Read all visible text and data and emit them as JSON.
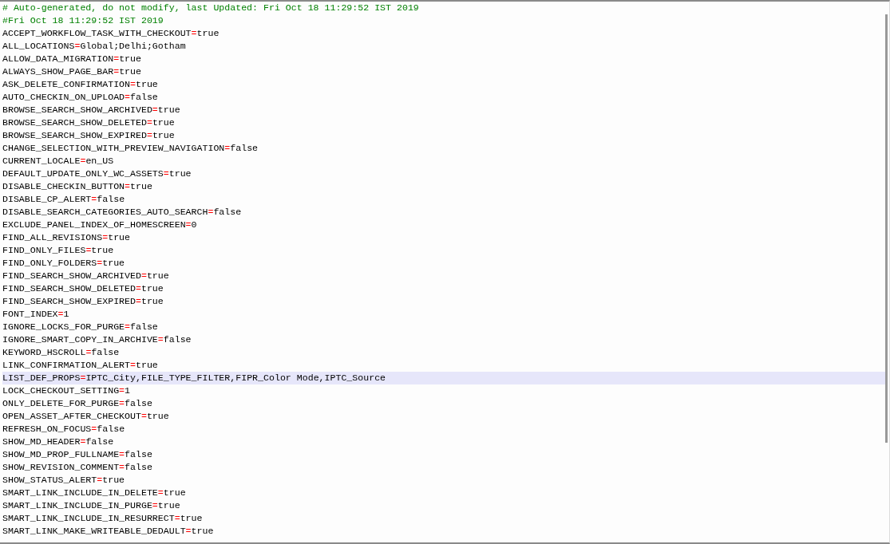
{
  "editor": {
    "comments": [
      "# Auto-generated, do not modify, last Updated: Fri Oct 18 11:29:52 IST 2019",
      "#Fri Oct 18 11:29:52 IST 2019"
    ],
    "properties": [
      {
        "key": "ACCEPT_WORKFLOW_TASK_WITH_CHECKOUT",
        "separator": "=",
        "value": "true",
        "selected": false
      },
      {
        "key": "ALL_LOCATIONS",
        "separator": "=",
        "value": "Global;Delhi;Gotham",
        "selected": false
      },
      {
        "key": "ALLOW_DATA_MIGRATION",
        "separator": "=",
        "value": "true",
        "selected": false
      },
      {
        "key": "ALWAYS_SHOW_PAGE_BAR",
        "separator": "=",
        "value": "true",
        "selected": false
      },
      {
        "key": "ASK_DELETE_CONFIRMATION",
        "separator": "=",
        "value": "true",
        "selected": false
      },
      {
        "key": "AUTO_CHECKIN_ON_UPLOAD",
        "separator": "=",
        "value": "false",
        "selected": false
      },
      {
        "key": "BROWSE_SEARCH_SHOW_ARCHIVED",
        "separator": "=",
        "value": "true",
        "selected": false
      },
      {
        "key": "BROWSE_SEARCH_SHOW_DELETED",
        "separator": "=",
        "value": "true",
        "selected": false
      },
      {
        "key": "BROWSE_SEARCH_SHOW_EXPIRED",
        "separator": "=",
        "value": "true",
        "selected": false
      },
      {
        "key": "CHANGE_SELECTION_WITH_PREVIEW_NAVIGATION",
        "separator": "=",
        "value": "false",
        "selected": false
      },
      {
        "key": "CURRENT_LOCALE",
        "separator": "=",
        "value": "en_US",
        "selected": false
      },
      {
        "key": "DEFAULT_UPDATE_ONLY_WC_ASSETS",
        "separator": "=",
        "value": "true",
        "selected": false
      },
      {
        "key": "DISABLE_CHECKIN_BUTTON",
        "separator": "=",
        "value": "true",
        "selected": false
      },
      {
        "key": "DISABLE_CP_ALERT",
        "separator": "=",
        "value": "false",
        "selected": false
      },
      {
        "key": "DISABLE_SEARCH_CATEGORIES_AUTO_SEARCH",
        "separator": "=",
        "value": "false",
        "selected": false
      },
      {
        "key": "EXCLUDE_PANEL_INDEX_OF_HOMESCREEN",
        "separator": "=",
        "value": "0",
        "selected": false
      },
      {
        "key": "FIND_ALL_REVISIONS",
        "separator": "=",
        "value": "true",
        "selected": false
      },
      {
        "key": "FIND_ONLY_FILES",
        "separator": "=",
        "value": "true",
        "selected": false
      },
      {
        "key": "FIND_ONLY_FOLDERS",
        "separator": "=",
        "value": "true",
        "selected": false
      },
      {
        "key": "FIND_SEARCH_SHOW_ARCHIVED",
        "separator": "=",
        "value": "true",
        "selected": false
      },
      {
        "key": "FIND_SEARCH_SHOW_DELETED",
        "separator": "=",
        "value": "true",
        "selected": false
      },
      {
        "key": "FIND_SEARCH_SHOW_EXPIRED",
        "separator": "=",
        "value": "true",
        "selected": false
      },
      {
        "key": "FONT_INDEX",
        "separator": "=",
        "value": "1",
        "selected": false
      },
      {
        "key": "IGNORE_LOCKS_FOR_PURGE",
        "separator": "=",
        "value": "false",
        "selected": false
      },
      {
        "key": "IGNORE_SMART_COPY_IN_ARCHIVE",
        "separator": "=",
        "value": "false",
        "selected": false
      },
      {
        "key": "KEYWORD_HSCROLL",
        "separator": "=",
        "value": "false",
        "selected": false
      },
      {
        "key": "LINK_CONFIRMATION_ALERT",
        "separator": "=",
        "value": "true",
        "selected": false
      },
      {
        "key": "LIST_DEF_PROPS",
        "separator": "=",
        "value": "IPTC_City,FILE_TYPE_FILTER,FIPR_Color Mode,IPTC_Source",
        "selected": true
      },
      {
        "key": "LOCK_CHECKOUT_SETTING",
        "separator": "=",
        "value": "1",
        "selected": false
      },
      {
        "key": "ONLY_DELETE_FOR_PURGE",
        "separator": "=",
        "value": "false",
        "selected": false
      },
      {
        "key": "OPEN_ASSET_AFTER_CHECKOUT",
        "separator": "=",
        "value": "true",
        "selected": false
      },
      {
        "key": "REFRESH_ON_FOCUS",
        "separator": "=",
        "value": "false",
        "selected": false
      },
      {
        "key": "SHOW_MD_HEADER",
        "separator": "=",
        "value": "false",
        "selected": false
      },
      {
        "key": "SHOW_MD_PROP_FULLNAME",
        "separator": "=",
        "value": "false",
        "selected": false
      },
      {
        "key": "SHOW_REVISION_COMMENT",
        "separator": "=",
        "value": "false",
        "selected": false
      },
      {
        "key": "SHOW_STATUS_ALERT",
        "separator": "=",
        "value": "true",
        "selected": false
      },
      {
        "key": "SMART_LINK_INCLUDE_IN_DELETE",
        "separator": "=",
        "value": "true",
        "selected": false
      },
      {
        "key": "SMART_LINK_INCLUDE_IN_PURGE",
        "separator": "=",
        "value": "true",
        "selected": false
      },
      {
        "key": "SMART_LINK_INCLUDE_IN_RESURRECT",
        "separator": "=",
        "value": "true",
        "selected": false
      },
      {
        "key": "SMART_LINK_MAKE_WRITEABLE_DEDAULT",
        "separator": "=",
        "value": "true",
        "selected": false
      }
    ]
  }
}
